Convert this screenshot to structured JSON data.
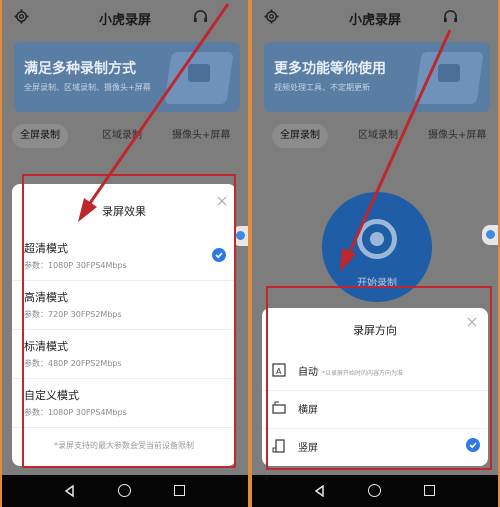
{
  "app_title": "小虎录屏",
  "left": {
    "banner": {
      "title": "满足多种录制方式",
      "subtitle": "全屏录制、区域录制、摄像头+屏幕"
    },
    "tabs": [
      "全屏录制",
      "区域录制",
      "摄像头+屏幕"
    ],
    "sheet": {
      "title": "录屏效果",
      "options": [
        {
          "name": "超清模式",
          "desc": "参数：1080P 30FPS4Mbps",
          "selected": true
        },
        {
          "name": "高清模式",
          "desc": "参数：720P 30FPS2Mbps",
          "selected": false
        },
        {
          "name": "标清模式",
          "desc": "参数：480P 20FPS2Mbps",
          "selected": false
        },
        {
          "name": "自定义模式",
          "desc": "参数：1080P 30FPS4Mbps",
          "selected": false
        }
      ],
      "note": "*录屏支持的最大参数会受当前设备限制"
    }
  },
  "right": {
    "banner": {
      "title": "更多功能等你使用",
      "subtitle": "视频处理工具、不定期更新"
    },
    "tabs": [
      "全屏录制",
      "区域录制",
      "摄像头+屏幕"
    ],
    "record_label": "开始录制",
    "sheet": {
      "title": "录屏方向",
      "options": [
        {
          "label": "自动",
          "hint": "*以录屏开始时的内容方向为准",
          "icon": "auto-rotate-icon",
          "selected": false
        },
        {
          "label": "横屏",
          "hint": "",
          "icon": "landscape-icon",
          "selected": false
        },
        {
          "label": "竖屏",
          "hint": "",
          "icon": "portrait-icon",
          "selected": true
        }
      ]
    }
  },
  "colors": {
    "accent": "#2d7be0",
    "annotation": "#c0262e",
    "frame": "#e08a3a"
  }
}
